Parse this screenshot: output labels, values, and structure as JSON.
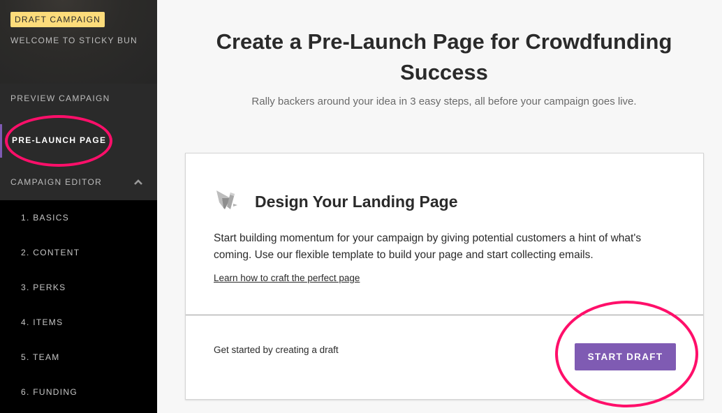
{
  "sidebar": {
    "badge": "DRAFT CAMPAIGN",
    "welcome": "WELCOME TO STICKY BUN",
    "preview": "PREVIEW CAMPAIGN",
    "prelaunch": "PRE-LAUNCH PAGE",
    "editor": "CAMPAIGN EDITOR",
    "editor_icon": "chevron-up-icon",
    "sub_items": [
      {
        "label": "1. BASICS"
      },
      {
        "label": "2. CONTENT"
      },
      {
        "label": "3. PERKS"
      },
      {
        "label": "4. ITEMS"
      },
      {
        "label": "5. TEAM"
      },
      {
        "label": "6. FUNDING"
      }
    ],
    "active_color": "#7f5bb3",
    "badge_color": "#fddc7b"
  },
  "main": {
    "title": "Create a Pre-Launch Page for Crowdfunding Success",
    "subtitle": "Rally backers around your idea in 3 easy steps, all before your campaign goes live.",
    "card": {
      "icon": "design-tools-icon",
      "title": "Design Your Landing Page",
      "description": "Start building momentum for your campaign by giving potential customers a hint of what's coming. Use our flexible template to build your page and start collecting emails.",
      "link": "Learn how to craft the perfect page",
      "footer_text": "Get started by creating a draft",
      "button": "START DRAFT",
      "button_color": "#7f5bb3"
    }
  },
  "annotation_color": "#ff0f6a"
}
